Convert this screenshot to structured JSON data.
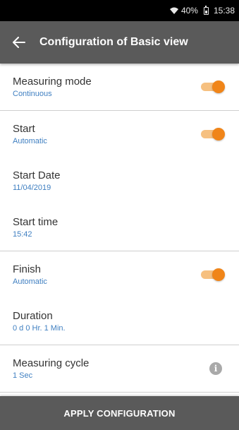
{
  "status_bar": {
    "wifi_icon": "wifi-icon",
    "battery_percent": "40%",
    "battery_icon": "battery-icon",
    "time": "15:38"
  },
  "app_bar": {
    "back_icon": "arrow-left-icon",
    "title": "Configuration of Basic view"
  },
  "settings": {
    "measuring_mode": {
      "label": "Measuring mode",
      "value": "Continuous",
      "toggle_on": true
    },
    "start": {
      "label": "Start",
      "value": "Automatic",
      "toggle_on": true
    },
    "start_date": {
      "label": "Start Date",
      "value": "11/04/2019"
    },
    "start_time": {
      "label": "Start time",
      "value": "15:42"
    },
    "finish": {
      "label": "Finish",
      "value": "Automatic",
      "toggle_on": true
    },
    "duration": {
      "label": "Duration",
      "value": "0 d 0 Hr. 1 Min."
    },
    "measuring_cycle": {
      "label": "Measuring cycle",
      "value": "1 Sec",
      "icon": "info-icon"
    }
  },
  "actions": {
    "apply_label": "APPLY CONFIGURATION"
  },
  "colors": {
    "accent_orange": "#f08519",
    "value_blue": "#3f7fc1",
    "bar_gray": "#5a5a5a"
  }
}
